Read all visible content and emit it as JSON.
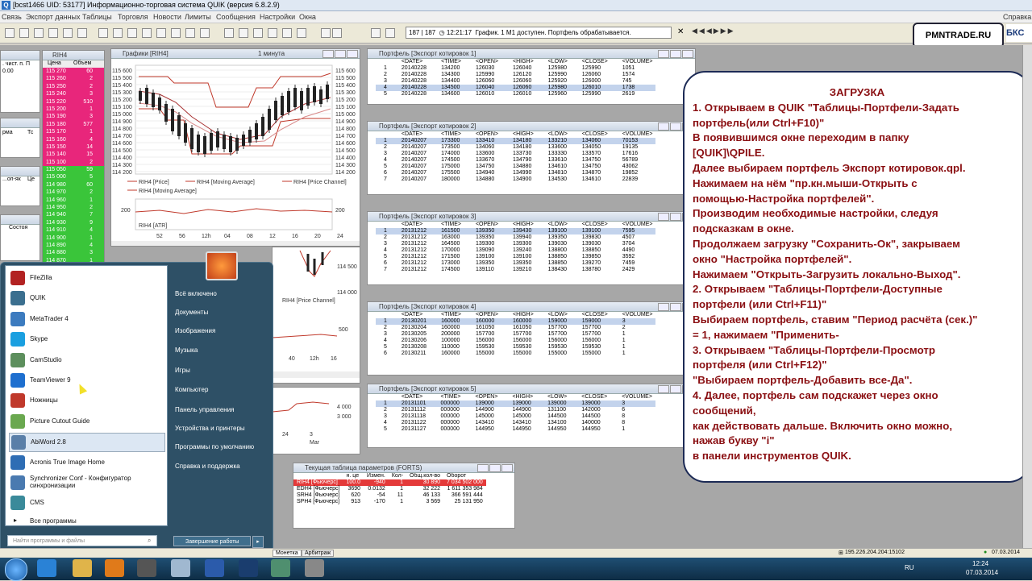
{
  "window": {
    "title": "[bcst1466  UID: 53177] Информационно-торговая система QUIK (версия 6.8.2.9)"
  },
  "menu": {
    "items": [
      "Связь",
      "Экспорт данных",
      "Таблицы",
      "Торговля",
      "Новости",
      "Лимиты",
      "Сообщения",
      "Настройки",
      "Окна"
    ],
    "help": "Справка"
  },
  "toolbar": {
    "interval": "M1",
    "counter": "187 | 187",
    "time": "12:21:17",
    "status": "График. 1 M1 доступен. Портфель обрабатывается."
  },
  "logo": {
    "text": "PMNTRADE.RU",
    "side": "БКС"
  },
  "left_panel": {
    "labels": [
      ". чист. п. П",
      "0.00",
      "рма",
      "Тс",
      "...оп-як",
      "Це",
      "Состоя"
    ]
  },
  "orderbook": {
    "title": "RIH4",
    "headers": [
      "Цена",
      "Объем"
    ],
    "rows": [
      {
        "price": "115 270",
        "vol": "60",
        "side": "sell"
      },
      {
        "price": "115 260",
        "vol": "2",
        "side": "sell"
      },
      {
        "price": "115 250",
        "vol": "2",
        "side": "sell"
      },
      {
        "price": "115 240",
        "vol": "3",
        "side": "sell"
      },
      {
        "price": "115 220",
        "vol": "510",
        "side": "sell"
      },
      {
        "price": "115 200",
        "vol": "1",
        "side": "sell"
      },
      {
        "price": "115 190",
        "vol": "3",
        "side": "sell"
      },
      {
        "price": "115 180",
        "vol": "577",
        "side": "sell"
      },
      {
        "price": "115 170",
        "vol": "1",
        "side": "sell"
      },
      {
        "price": "115 160",
        "vol": "4",
        "side": "sell"
      },
      {
        "price": "115 150",
        "vol": "14",
        "side": "sell"
      },
      {
        "price": "115 140",
        "vol": "15",
        "side": "sell"
      },
      {
        "price": "115 100",
        "vol": "2",
        "side": "sell"
      },
      {
        "price": "115 050",
        "vol": "59",
        "side": "buy"
      },
      {
        "price": "115 000",
        "vol": "5",
        "side": "buy"
      },
      {
        "price": "114 980",
        "vol": "60",
        "side": "buy"
      },
      {
        "price": "114 970",
        "vol": "2",
        "side": "buy"
      },
      {
        "price": "114 960",
        "vol": "1",
        "side": "buy"
      },
      {
        "price": "114 950",
        "vol": "2",
        "side": "buy"
      },
      {
        "price": "114 940",
        "vol": "7",
        "side": "buy"
      },
      {
        "price": "114 930",
        "vol": "9",
        "side": "buy"
      },
      {
        "price": "114 910",
        "vol": "4",
        "side": "buy"
      },
      {
        "price": "114 900",
        "vol": "1",
        "side": "buy"
      },
      {
        "price": "114 890",
        "vol": "4",
        "side": "buy"
      },
      {
        "price": "114 880",
        "vol": "3",
        "side": "buy"
      },
      {
        "price": "114 870",
        "vol": "1",
        "side": "buy"
      },
      {
        "price": "114 630",
        "vol": "15",
        "side": "buy"
      }
    ]
  },
  "chart_window": {
    "title": "Графики [RIH4]",
    "interval": "1 минута",
    "y_ticks": [
      "115 600",
      "115 500",
      "115 400",
      "115 300",
      "115 200",
      "115 100",
      "115 000",
      "114 900",
      "114 800",
      "114 700",
      "114 600",
      "114 500",
      "114 400",
      "114 300",
      "114 200"
    ],
    "legend": [
      "RIH4 [Price]",
      "RIH4 [Moving Average]",
      "RIH4 [Price Channel]",
      "RIH4 [Moving Average]"
    ],
    "atr_label": "RIH4 [ATR]",
    "atr_tick": "200",
    "x_ticks": [
      "52",
      "56",
      "12h",
      "04",
      "08",
      "12",
      "16",
      "20",
      "24"
    ]
  },
  "lower_chart": {
    "y_ticks": [
      "114 500",
      "114 000"
    ],
    "label": "RIH4 [Price Channel]",
    "atr_tick": "500",
    "x_ticks": [
      "40",
      "12h",
      "16"
    ],
    "y_ticks2": [
      "4 000",
      "3 000"
    ],
    "x_ticks2": [
      "24",
      "3",
      "Mar"
    ]
  },
  "portfolio_headers": [
    "<DATE>",
    "<TIME>",
    "<OPEN>",
    "<HIGH>",
    "<LOW>",
    "<CLOSE>",
    "<VOLUME>"
  ],
  "portfolios": [
    {
      "title": "Портфель [Экспорт котировок 1]",
      "rows": [
        [
          "1",
          "20140228",
          "134200",
          "126030",
          "126040",
          "125980",
          "125990",
          "1051"
        ],
        [
          "2",
          "20140228",
          "134300",
          "125990",
          "126120",
          "125990",
          "126060",
          "1574"
        ],
        [
          "3",
          "20140228",
          "134400",
          "126060",
          "126060",
          "125920",
          "126000",
          "745"
        ],
        [
          "4",
          "20140228",
          "134500",
          "126040",
          "126060",
          "125980",
          "126010",
          "1738"
        ],
        [
          "5",
          "20140228",
          "134600",
          "126010",
          "126010",
          "125960",
          "125990",
          "2619"
        ]
      ],
      "sel": 3
    },
    {
      "title": "Портфель [Экспорт котировок 2]",
      "rows": [
        [
          "1",
          "20140207",
          "173300",
          "133410",
          "134180",
          "133210",
          "134060",
          "70153"
        ],
        [
          "2",
          "20140207",
          "173500",
          "134060",
          "134180",
          "133600",
          "134050",
          "19135"
        ],
        [
          "3",
          "20140207",
          "174000",
          "133600",
          "133730",
          "133330",
          "133570",
          "17616"
        ],
        [
          "4",
          "20140207",
          "174500",
          "133670",
          "134790",
          "133610",
          "134750",
          "56789"
        ],
        [
          "5",
          "20140207",
          "175000",
          "134750",
          "134880",
          "134610",
          "134750",
          "43062"
        ],
        [
          "6",
          "20140207",
          "175500",
          "134940",
          "134990",
          "134810",
          "134870",
          "19852"
        ],
        [
          "7",
          "20140207",
          "180000",
          "134880",
          "134900",
          "134530",
          "134610",
          "22839"
        ]
      ],
      "sel": 0
    },
    {
      "title": "Портфель [Экспорт котировок 3]",
      "rows": [
        [
          "1",
          "20131212",
          "161500",
          "139350",
          "139430",
          "139100",
          "139100",
          "7595"
        ],
        [
          "2",
          "20131212",
          "163000",
          "139350",
          "139940",
          "139350",
          "139830",
          "4507"
        ],
        [
          "3",
          "20131212",
          "164500",
          "139300",
          "139300",
          "139030",
          "139030",
          "3704"
        ],
        [
          "4",
          "20131212",
          "170000",
          "139090",
          "139240",
          "138800",
          "138850",
          "4490"
        ],
        [
          "5",
          "20131212",
          "171500",
          "139100",
          "139100",
          "138850",
          "139850",
          "3592"
        ],
        [
          "6",
          "20131212",
          "173000",
          "139350",
          "139350",
          "138850",
          "139270",
          "7459"
        ],
        [
          "7",
          "20131212",
          "174500",
          "139110",
          "139210",
          "138430",
          "138780",
          "2429"
        ]
      ],
      "sel": 0
    },
    {
      "title": "Портфель [Экспорт котировок 4]",
      "rows": [
        [
          "1",
          "20130201",
          "160000",
          "160000",
          "160000",
          "159000",
          "159000",
          "3"
        ],
        [
          "2",
          "20130204",
          "160000",
          "161050",
          "161050",
          "157700",
          "157700",
          "2"
        ],
        [
          "3",
          "20130205",
          "200000",
          "157700",
          "157700",
          "157700",
          "157700",
          "1"
        ],
        [
          "4",
          "20130206",
          "100000",
          "156000",
          "156000",
          "156000",
          "156000",
          "1"
        ],
        [
          "5",
          "20130208",
          "110000",
          "159530",
          "159530",
          "159530",
          "159530",
          "1"
        ],
        [
          "6",
          "20130211",
          "160000",
          "155000",
          "155000",
          "155000",
          "155000",
          "1"
        ]
      ],
      "sel": 0
    },
    {
      "title": "Портфель [Экспорт котировок 5]",
      "rows": [
        [
          "1",
          "20131101",
          "000000",
          "139000",
          "139000",
          "139000",
          "139000",
          "3"
        ],
        [
          "2",
          "20131112",
          "000000",
          "144900",
          "144900",
          "131100",
          "142000",
          "6"
        ],
        [
          "3",
          "20131118",
          "000000",
          "145000",
          "145000",
          "144500",
          "144500",
          "8"
        ],
        [
          "4",
          "20131122",
          "000000",
          "143410",
          "143410",
          "134100",
          "140000",
          "8"
        ],
        [
          "5",
          "20131127",
          "000000",
          "144950",
          "144950",
          "144950",
          "144950",
          "1"
        ]
      ],
      "sel": 0
    }
  ],
  "params_table": {
    "title": "Текущая таблица параметров (FORTS)",
    "headers": [
      "",
      "н. це",
      "Измен.",
      "Кол-",
      "Общ.кол-во",
      "Оборот"
    ],
    "rows": [
      [
        "RIH4 [Фьючерс]",
        "100.0",
        "-940",
        "1",
        "30 890",
        "7 034 502 000"
      ],
      [
        "EDH4 [Фьючерс]",
        "3690",
        "0.0132",
        "1",
        "32 222",
        "1 611 353 984"
      ],
      [
        "SRH4 [Фьючерс]",
        "620",
        "-54",
        "11",
        "46 133",
        "366 591 444"
      ],
      [
        "SPH4 [Фьючерс]",
        "913",
        "-170",
        "1",
        "3 569",
        "25 131 950"
      ]
    ]
  },
  "info": {
    "heading": "ЗАГРУЗКА",
    "lines": [
      "1. Открываем в QUIK \"Таблицы-Портфели-Задать",
      "портфель(или Ctrl+F10)\"",
      "В появившимся окне переходим в папку",
      "[QUIK]\\QPILE.",
      "Далее выбираем портфель Экспорт котировок.qpl.",
      "Нажимаем на нём \"пр.кн.мыши-Открыть с",
      "помощью-Настройка портфелей\".",
      "Производим необходимые настройки, следуя",
      "подсказкам в окне.",
      "Продолжаем загрузку \"Сохранить-Ок\", закрываем",
      "окно \"Настройка портфелей\".",
      "Нажимаем \"Открыть-Загрузить локально-Выход\".",
      "2. Открываем \"Таблицы-Портфели-Доступные",
      "портфели (или Ctrl+F11)\"",
      "Выбираем портфель, ставим \"Период расчёта (сек.)\"",
      "= 1, нажимаем \"Применить-",
      "3. Открываем \"Таблицы-Портфели-Просмотр",
      "портфеля (или Ctrl+F12)\"",
      "\"Выбираем портфель-Добавить все-Да\".",
      "4. Далее, портфель сам подскажет через окно",
      "сообщений,",
      "как действовать дальше. Включить окно можно,",
      "нажав букву \"i\"",
      "в панели инструментов QUIK."
    ]
  },
  "start_menu": {
    "programs": [
      {
        "label": "FileZilla",
        "color": "#b22222"
      },
      {
        "label": "QUIK",
        "color": "#3b6f8f"
      },
      {
        "label": "MetaTrader 4",
        "color": "#3c7bbf"
      },
      {
        "label": "Skype",
        "color": "#1a9fe0"
      },
      {
        "label": "CamStudio",
        "color": "#5d8f5d"
      },
      {
        "label": "TeamViewer 9",
        "color": "#1e6fcf"
      },
      {
        "label": "Ножницы",
        "color": "#c0392b"
      },
      {
        "label": "Picture Cutout Guide",
        "color": "#6aa84f"
      },
      {
        "label": "AbiWord 2.8",
        "color": "#5a7fa8"
      },
      {
        "label": "Acronis True Image Home",
        "color": "#2e6db4"
      },
      {
        "label": "Synchronizer Conf - Конфигуратор синхронизации",
        "color": "#4a7ab0"
      },
      {
        "label": "CMS",
        "color": "#3a8a9a"
      }
    ],
    "all_programs": "Все программы",
    "search_placeholder": "Найти программы и файлы",
    "right": [
      "Всё включено",
      "Документы",
      "Изображения",
      "Музыка",
      "Игры",
      "Компьютер",
      "Панель управления",
      "Устройства и принтеры",
      "Программы по умолчанию",
      "Справка и поддержка"
    ],
    "shutdown": "Завершение работы"
  },
  "statusbar": {
    "tabs": [
      "Монетка",
      "Арбитраж"
    ],
    "ip": "195.226.204.204:15102",
    "date": "07.03.2014"
  },
  "taskbar": {
    "lang": "RU",
    "time": "12:24",
    "date": "07.03.2014"
  }
}
